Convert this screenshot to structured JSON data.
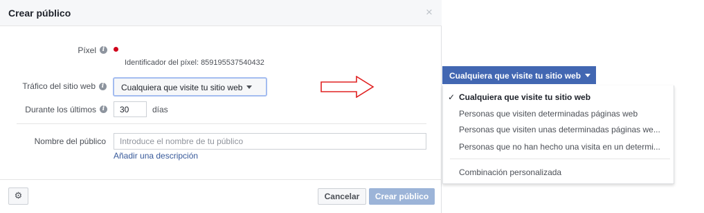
{
  "dialog": {
    "title": "Crear público",
    "close": "×"
  },
  "pixel": {
    "label": "Píxel",
    "status_color": "#d0021b",
    "identifier": "Identificador del píxel: 859195537540432"
  },
  "traffic": {
    "label": "Tráfico del sitio web",
    "selected": "Cualquiera que visite tu sitio web"
  },
  "duration": {
    "label": "Durante los últimos",
    "value": "30",
    "unit": "días"
  },
  "audience_name": {
    "label": "Nombre del público",
    "placeholder": "Introduce el nombre de tu público",
    "add_description": "Añadir una descripción"
  },
  "footer": {
    "cancel": "Cancelar",
    "create": "Crear público"
  },
  "dropdown": {
    "button_label": "Cualquiera que visite tu sitio web",
    "check": "✓",
    "options": [
      "Cualquiera que visite tu sitio web",
      "Personas que visiten determinadas páginas web",
      "Personas que visiten unas determinadas páginas we...",
      "Personas que no han hecho una visita en un determi...",
      "Combinación personalizada"
    ]
  },
  "colors": {
    "accent": "#4267b2",
    "arrow": "#e02020",
    "link": "#365899"
  },
  "icons": [
    "info-icon",
    "gear-icon",
    "close-icon",
    "right-arrow-icon",
    "checkmark-icon",
    "caret-down-icon"
  ]
}
